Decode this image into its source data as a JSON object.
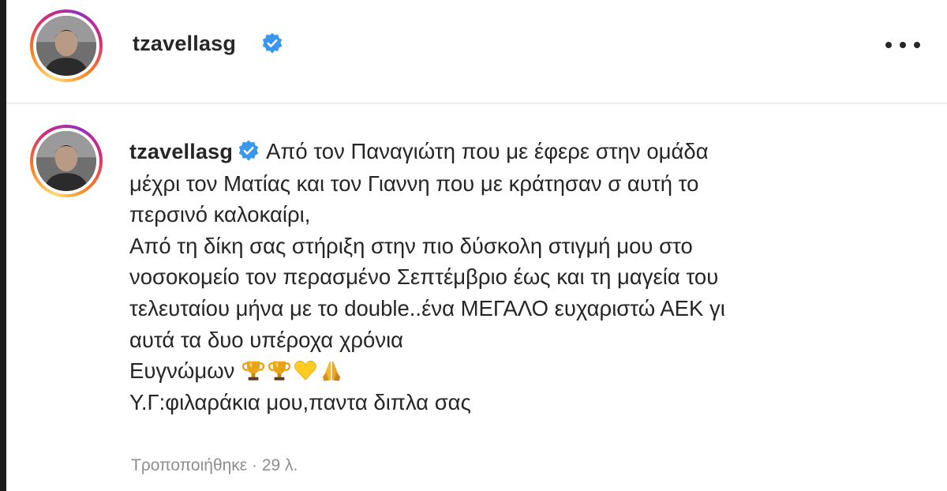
{
  "post": {
    "username": "tzavellasg",
    "more_label": "..."
  },
  "caption": {
    "username": "tzavellasg",
    "lines": [
      "Από τον Παναγιώτη που με έφερε στην ομάδα",
      "μέχρι τον Ματίας και τον Γιαννη που με κράτησαν σ αυτή το",
      "περσινό καλοκαίρι,",
      "Από τη δίκη σας στήριξη στην πιο δύσκολη στιγμή μου στο",
      "νοσοκομείο τον περασμένο Σεπτέμβριο έως και τη μαγεία του",
      "τελευταίου μήνα με το double..ένα ΜΕΓΑΛΟ ευχαριστώ ΑΕΚ γι",
      "αυτά τα δυο υπέροχα χρόνια",
      "Ευγνώμων",
      "Υ.Γ:φιλαράκια μου,παντα διπλα σας"
    ],
    "emojis": [
      "trophy",
      "trophy",
      "yellow-heart",
      "folded-hands"
    ]
  },
  "meta": {
    "text": "Τροποποιήθηκε · 29 λ."
  },
  "colors": {
    "verified": "#3897f0",
    "text": "#262626",
    "muted": "#8e8e8e",
    "divider": "#efefef"
  }
}
